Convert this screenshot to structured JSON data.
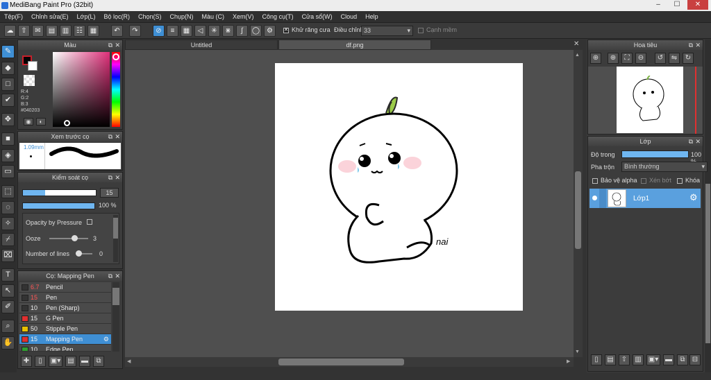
{
  "app": {
    "title": "MediBang Paint Pro (32bit)",
    "controls": [
      "–",
      "☐",
      "✕"
    ]
  },
  "menu": [
    "Tệp(F)",
    "Chỉnh sửa(E)",
    "Lớp(L)",
    "Bộ lọc(R)",
    "Chọn(S)",
    "Chụp(N)",
    "Màu (C)",
    "Xem(V)",
    "Công cụ(T)",
    "Cửa sổ(W)",
    "Cloud",
    "Help"
  ],
  "toolbar": {
    "antialias_label": "Khử răng cưa",
    "correction_label": "Điều chỉnh",
    "correction_value": "33",
    "edge_label": "Cạnh mềm"
  },
  "color_panel": {
    "title": "Màu",
    "r": "R:4",
    "g": "G:2",
    "b": "B:3",
    "hex": "#040203",
    "fg": "#040203",
    "accent": "#c8202a"
  },
  "brush_preview": {
    "title": "Xem trước cọ",
    "size": "1.09mm"
  },
  "brush_control": {
    "title": "Kiểm soát cọ",
    "size_value": "15",
    "opacity_value": "100 %",
    "opacity_pressure_label": "Opacity by Pressure",
    "ooze_label": "Ooze",
    "ooze_value": "3",
    "lines_label": "Number of lines",
    "lines_value": "0"
  },
  "brush_list": {
    "title": "Cọ: Mapping Pen",
    "items": [
      {
        "size": "6.7",
        "name": "Pencil",
        "color": "#3a3a3a",
        "red": true
      },
      {
        "size": "15",
        "name": "Pen",
        "color": "#3a3a3a",
        "red": true
      },
      {
        "size": "10",
        "name": "Pen (Sharp)",
        "color": "#3a3a3a",
        "red": false
      },
      {
        "size": "15",
        "name": "G Pen",
        "color": "#e03030",
        "red": false
      },
      {
        "size": "50",
        "name": "Stipple Pen",
        "color": "#e8c000",
        "red": false
      },
      {
        "size": "15",
        "name": "Mapping Pen",
        "color": "#e03030",
        "red": false
      },
      {
        "size": "10",
        "name": "Edge Pen",
        "color": "#30a030",
        "red": false
      }
    ]
  },
  "tabs": [
    "Untitled",
    "df.png"
  ],
  "canvas": {
    "signature": "nai"
  },
  "navigator": {
    "title": "Hoa tiêu"
  },
  "layers": {
    "title": "Lớp",
    "opacity_label": "Độ trong",
    "opacity_value": "100 %",
    "blend_label": "Pha trộn",
    "blend_value": "Bình thường",
    "protect_alpha": "Bảo vệ alpha",
    "clipping": "Xén bớt",
    "lock": "Khóa",
    "layer_name": "Lớp1"
  }
}
